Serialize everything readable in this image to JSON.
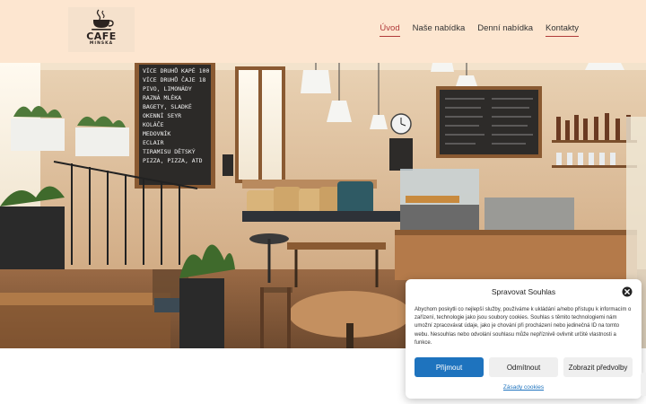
{
  "logo": {
    "name": "CAFE",
    "subtitle": "MINSKA"
  },
  "nav": {
    "items": [
      {
        "label": "Úvod",
        "state": "active"
      },
      {
        "label": "Naše nabídka",
        "state": "normal"
      },
      {
        "label": "Denní nabídka",
        "state": "normal"
      },
      {
        "label": "Kontakty",
        "state": "underlined"
      }
    ],
    "active_color": "#b03a3a"
  },
  "hero": {
    "chalkboard_lines": [
      "VÍCE DRUHŮ KAPÉ 100",
      "VÍCE DRUHŮ ČAJE 18",
      "PIVO, LIMONÁDY",
      "RAZNÁ MLÉKA",
      "BAGETY, SLADKÉ",
      "OKENNÍ SEYR",
      "KOLÁČE",
      "MEDOVNÍK",
      "ECLAIR",
      "TIRAMISU DĚTSKÝ",
      "PIZZA, PIZZA, ATD"
    ]
  },
  "consent": {
    "title": "Spravovat Souhlas",
    "text": "Abychom poskytli co nejlepší služby, používáme k ukládání a/nebo přístupu k informacím o zařízení, technologie jako jsou soubory cookies. Souhlas s těmito technologiemi nám umožní zpracovávat údaje, jako je chování při procházení nebo jedinečná ID na tomto webu. Nesouhlas nebo odvolání souhlasu může nepříznivě ovlivnit určité vlastnosti a funkce.",
    "accept_label": "Přijmout",
    "reject_label": "Odmítnout",
    "prefs_label": "Zobrazit předvolby",
    "policy_link": "Zásady cookies"
  },
  "colors": {
    "header_bg": "#fde6d0",
    "accept_button": "#1e73be",
    "link": "#1e73be"
  },
  "icons": {
    "close": "close-icon",
    "logo_cup": "coffee-cup-icon"
  }
}
